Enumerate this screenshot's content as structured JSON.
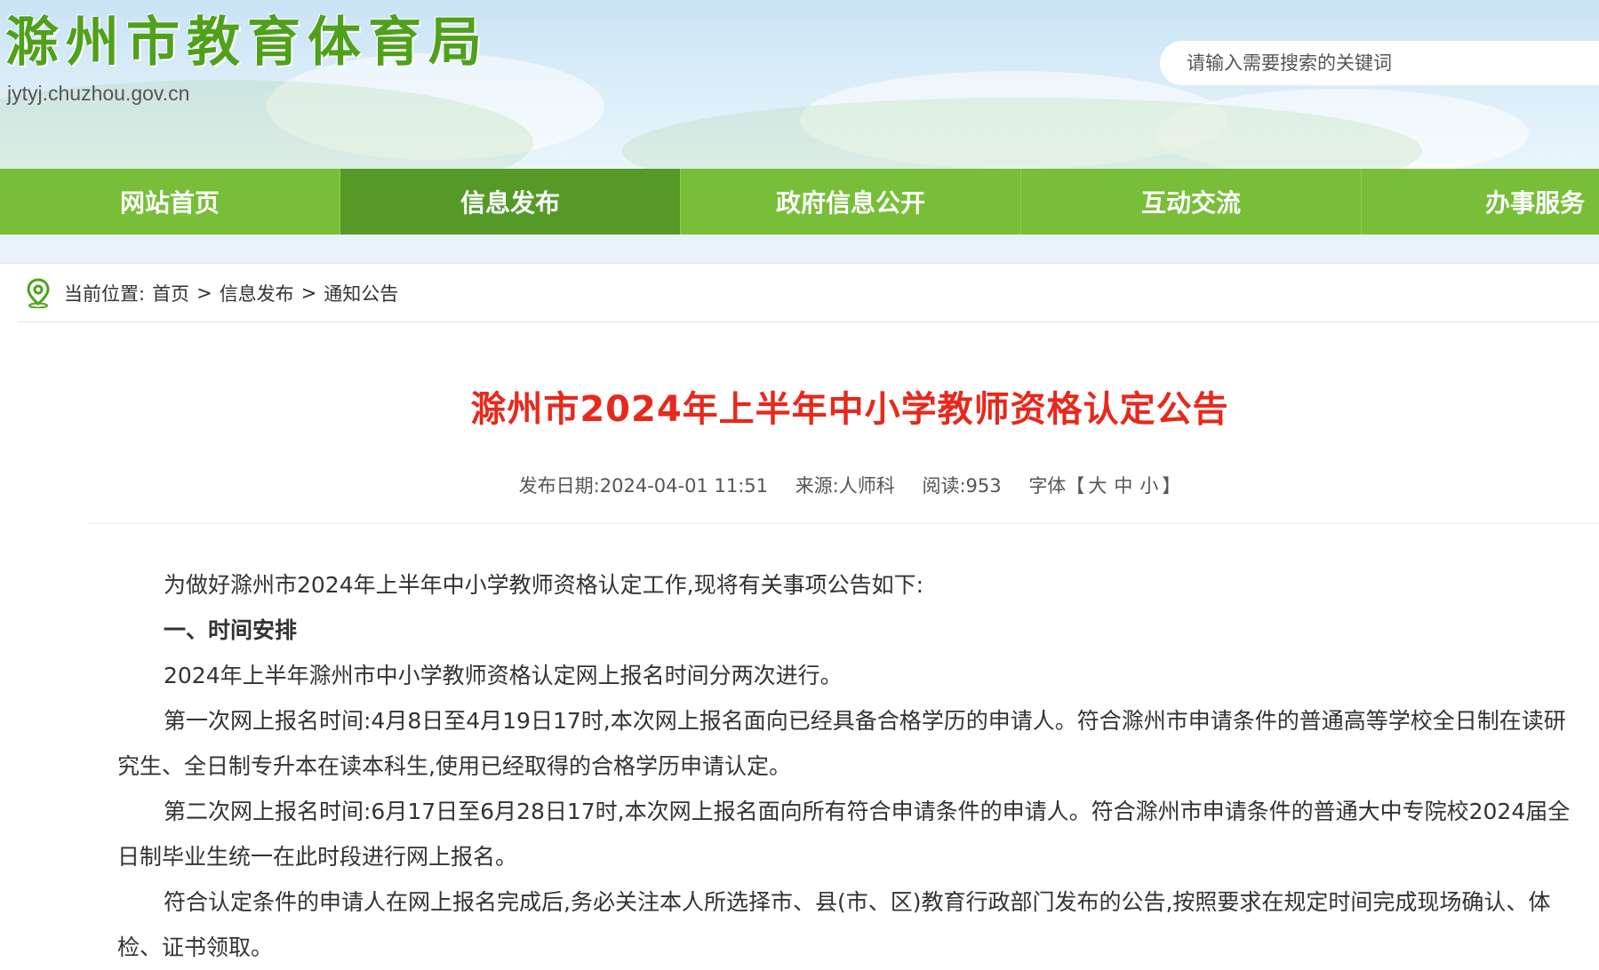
{
  "header": {
    "site_title": "滁州市教育体育局",
    "site_url": "jytyj.chuzhou.gov.cn",
    "search_placeholder": "请输入需要搜索的关键词"
  },
  "nav": {
    "items": [
      {
        "label": "网站首页"
      },
      {
        "label": "信息发布"
      },
      {
        "label": "政府信息公开"
      },
      {
        "label": "互动交流"
      },
      {
        "label": "办事服务"
      }
    ],
    "active": "信息发布"
  },
  "breadcrumb": {
    "prefix": "当前位置:",
    "items": [
      "首页",
      "信息发布",
      "通知公告"
    ],
    "separator": ">"
  },
  "article": {
    "title": "滁州市2024年上半年中小学教师资格认定公告",
    "meta": {
      "date_label": "发布日期:",
      "date": "2024-04-01 11:51",
      "source_label": "来源:",
      "source": "人师科",
      "views_label": "阅读:",
      "views": "953",
      "font_label": "字体【",
      "font_large": "大",
      "font_medium": "中",
      "font_small": "小",
      "font_close": "】"
    },
    "paragraphs": [
      "为做好滁州市2024年上半年中小学教师资格认定工作,现将有关事项公告如下:",
      "一、时间安排",
      "2024年上半年滁州市中小学教师资格认定网上报名时间分两次进行。",
      "第一次网上报名时间:4月8日至4月19日17时,本次网上报名面向已经具备合格学历的申请人。符合滁州市申请条件的普通高等学校全日制在读研究生、全日制专升本在读本科生,使用已经取得的合格学历申请认定。",
      "第二次网上报名时间:6月17日至6月28日17时,本次网上报名面向所有符合申请条件的申请人。符合滁州市申请条件的普通大中专院校2024届全日制毕业生统一在此时段进行网上报名。",
      "符合认定条件的申请人在网上报名完成后,务必关注本人所选择市、县(市、区)教育行政部门发布的公告,按照要求在规定时间完成现场确认、体检、证书领取。"
    ]
  },
  "colors": {
    "nav_green": "#78be38",
    "nav_active": "#559a27",
    "title_red": "#e8281c",
    "logo_green": "#4fa11c"
  }
}
